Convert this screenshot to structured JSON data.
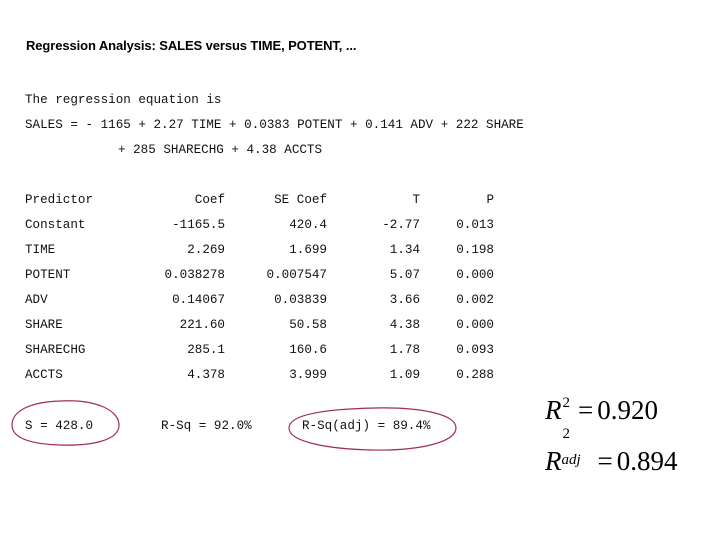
{
  "title": "Regression Analysis: SALES versus TIME, POTENT, ...",
  "equation": {
    "intro": "The regression equation is",
    "line1": "SALES = - 1165 + 2.27 TIME + 0.0383 POTENT + 0.141 ADV + 222 SHARE",
    "line2": "+ 285 SHARECHG + 4.38 ACCTS"
  },
  "table": {
    "headers": [
      "Predictor",
      "Coef",
      "SE Coef",
      "T",
      "P"
    ],
    "rows": [
      [
        "Constant",
        "-1165.5",
        "420.4",
        "-2.77",
        "0.013"
      ],
      [
        "TIME",
        "2.269",
        "1.699",
        "1.34",
        "0.198"
      ],
      [
        "POTENT",
        "0.038278",
        "0.007547",
        "5.07",
        "0.000"
      ],
      [
        "ADV",
        "0.14067",
        "0.03839",
        "3.66",
        "0.002"
      ],
      [
        "SHARE",
        "221.60",
        "50.58",
        "4.38",
        "0.000"
      ],
      [
        "SHARECHG",
        "285.1",
        "160.6",
        "1.78",
        "0.093"
      ],
      [
        "ACCTS",
        "4.378",
        "3.999",
        "1.09",
        "0.288"
      ]
    ]
  },
  "summary": {
    "s": "S = 428.0",
    "rsq": "R-Sq = 92.0%",
    "rsq_adj": "R-Sq(adj) = 89.4%"
  },
  "annotations": {
    "highlight_color": "#a0304a",
    "r2": {
      "symbol": "R",
      "superscript": "2",
      "equals": "=",
      "value": "0.920"
    },
    "r2_adj": {
      "symbol": "R",
      "superscript": "2",
      "subscript": "adj",
      "equals": "=",
      "value": "0.894"
    }
  }
}
